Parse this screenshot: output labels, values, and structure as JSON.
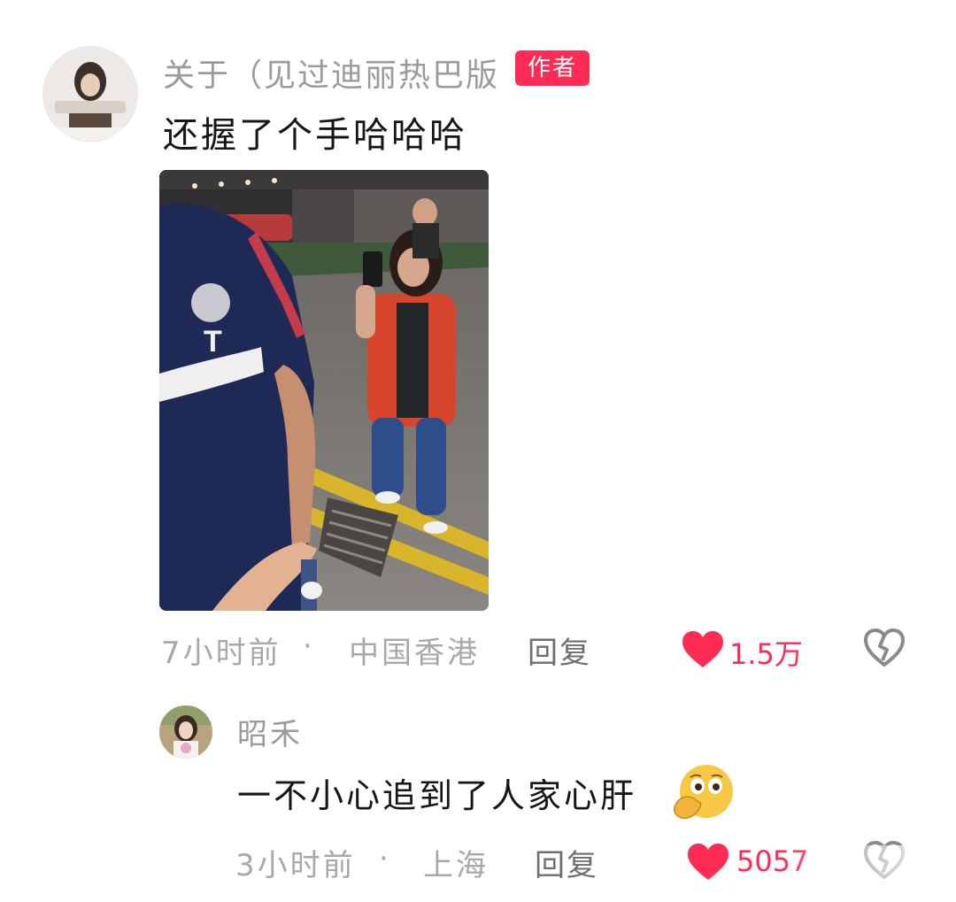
{
  "comments": [
    {
      "username": "关于（见过迪丽热巴版",
      "badge": "作者",
      "text": "还握了个手哈哈哈",
      "time": "7小时前",
      "separator": "·",
      "location": "中国香港",
      "reply_label": "回复",
      "likes": "1.5万",
      "avatar_icon": "user-avatar",
      "like_icon": "heart-filled-icon",
      "dislike_icon": "broken-heart-icon"
    }
  ],
  "replies": [
    {
      "username": "昭禾",
      "text": "一不小心追到了人家心肝",
      "emoji": "hand-over-mouth-emoji",
      "time": "3小时前",
      "separator": "·",
      "location": "上海",
      "reply_label": "回复",
      "likes": "5057",
      "avatar_icon": "user-avatar",
      "like_icon": "heart-filled-icon",
      "dislike_icon": "broken-heart-icon"
    }
  ],
  "colors": {
    "accent": "#fe2c55",
    "meta_gray": "#a8a8a8",
    "username_gray": "#9b9b9b",
    "text": "#161616",
    "background": "#ffffff"
  }
}
